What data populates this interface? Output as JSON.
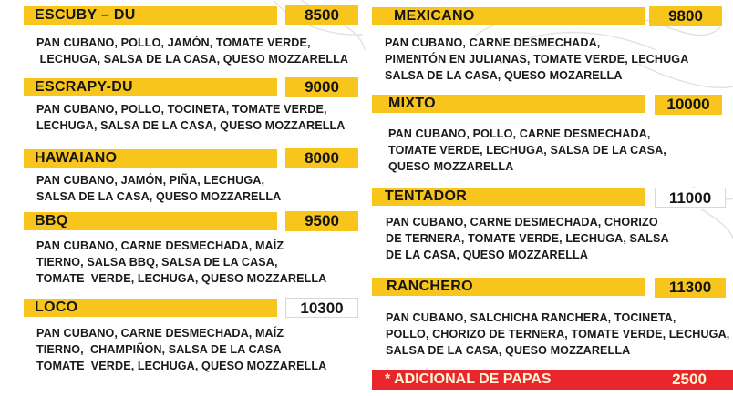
{
  "colors": {
    "accent": "#f7c51c",
    "extra": "#e8262b",
    "text": "#141414"
  },
  "left": [
    {
      "name": "ESCUBY – DU",
      "price": "8500",
      "desc": [
        "PAN CUBANO, POLLO, JAMÓN, TOMATE VERDE,",
        " LECHUGA, SALSA DE LA CASA, QUESO MOZZARELLA"
      ]
    },
    {
      "name": "ESCRAPY-DU",
      "price": "9000",
      "desc": [
        "PAN CUBANO, POLLO, TOCINETA, TOMATE VERDE,",
        "LECHUGA, SALSA DE LA CASA, QUESO MOZZARELLA"
      ]
    },
    {
      "name": "HAWAIANO",
      "price": "8000",
      "desc": [
        "PAN CUBANO, JAMÓN, PIÑA, LECHUGA,",
        "SALSA DE LA CASA, QUESO MOZZARELLA"
      ]
    },
    {
      "name": "BBQ",
      "price": "9500",
      "desc": [
        "PAN CUBANO, CARNE DESMECHADA, MAÍZ",
        "TIERNO, SALSA BBQ, SALSA DE LA CASA,",
        "TOMATE  VERDE, LECHUGA, QUESO MOZZARELLA"
      ]
    },
    {
      "name": "LOCO",
      "price": "10300",
      "desc": [
        "PAN CUBANO, CARNE DESMECHADA, MAÍZ",
        "TIERNO,  CHAMPIÑON, SALSA DE LA CASA",
        "TOMATE  VERDE, LECHUGA, QUESO MOZZARELLA"
      ]
    }
  ],
  "right": [
    {
      "name": "MEXICANO",
      "price": "9800",
      "desc": [
        "PAN CUBANO, CARNE DESMECHADA,",
        "PIMENTÓN EN JULIANAS, TOMATE VERDE, LECHUGA",
        "SALSA DE LA CASA, QUESO MOZARELLA"
      ]
    },
    {
      "name": "MIXTO",
      "price": "10000",
      "desc": [
        "PAN CUBANO, POLLO, CARNE DESMECHADA,",
        "TOMATE VERDE, LECHUGA, SALSA DE LA CASA,",
        "QUESO MOZZARELLA"
      ]
    },
    {
      "name": "TENTADOR",
      "price": "11000",
      "desc": [
        "PAN CUBANO, CARNE DESMECHADA, CHORIZO",
        "DE TERNERA, TOMATE VERDE, LECHUGA, SALSA",
        "DE LA CASA, QUESO MOZZARELLA"
      ]
    },
    {
      "name": "RANCHERO",
      "price": "11300",
      "desc": [
        "PAN CUBANO, SALCHICHA RANCHERA, TOCINETA,",
        "POLLO, CHORIZO DE TERNERA, TOMATE VERDE, LECHUGA,",
        "SALSA DE LA CASA, QUESO MOZZARELLA"
      ]
    }
  ],
  "extra": {
    "label": "* ADICIONAL DE PAPAS",
    "price": "2500"
  }
}
